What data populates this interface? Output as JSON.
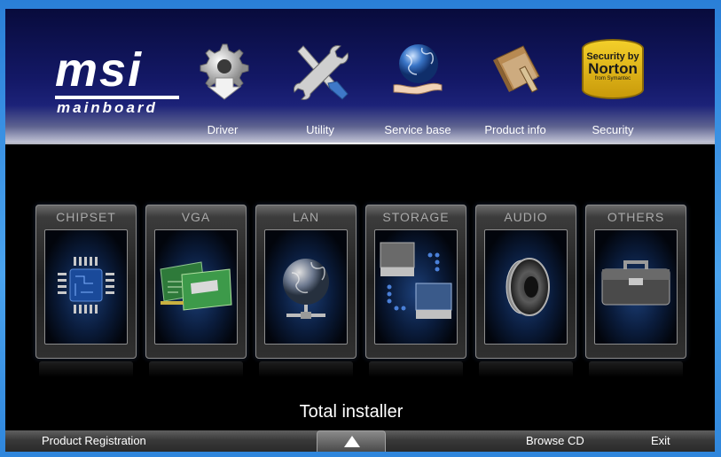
{
  "header": {
    "logo_text": "msi",
    "logo_subtext": "mainboard",
    "tabs": [
      {
        "label": "Driver",
        "icon": "gear-down-arrow-icon"
      },
      {
        "label": "Utility",
        "icon": "wrench-screwdriver-icon"
      },
      {
        "label": "Service base",
        "icon": "globe-hand-icon"
      },
      {
        "label": "Product info",
        "icon": "book-icon"
      },
      {
        "label": "Security",
        "icon": "norton-seal-icon",
        "badge_lines": [
          "Security by",
          "Norton",
          "from Symantec"
        ]
      }
    ]
  },
  "categories": [
    {
      "label": "CHIPSET",
      "icon": "chip-icon"
    },
    {
      "label": "VGA",
      "icon": "graphics-card-icon"
    },
    {
      "label": "LAN",
      "icon": "network-globe-icon"
    },
    {
      "label": "STORAGE",
      "icon": "hard-drive-icon"
    },
    {
      "label": "AUDIO",
      "icon": "speaker-icon"
    },
    {
      "label": "OTHERS",
      "icon": "toolbox-icon"
    }
  ],
  "total_installer": "Total installer",
  "footer": {
    "product_registration": "Product Registration",
    "browse_cd": "Browse CD",
    "exit": "Exit",
    "expand_icon": "triangle-up-icon"
  },
  "colors": {
    "header_dark": "#080b3c",
    "header_mid": "#1c2278",
    "card_text": "#a9a9a9",
    "screen_glow": "#1c3f78"
  }
}
